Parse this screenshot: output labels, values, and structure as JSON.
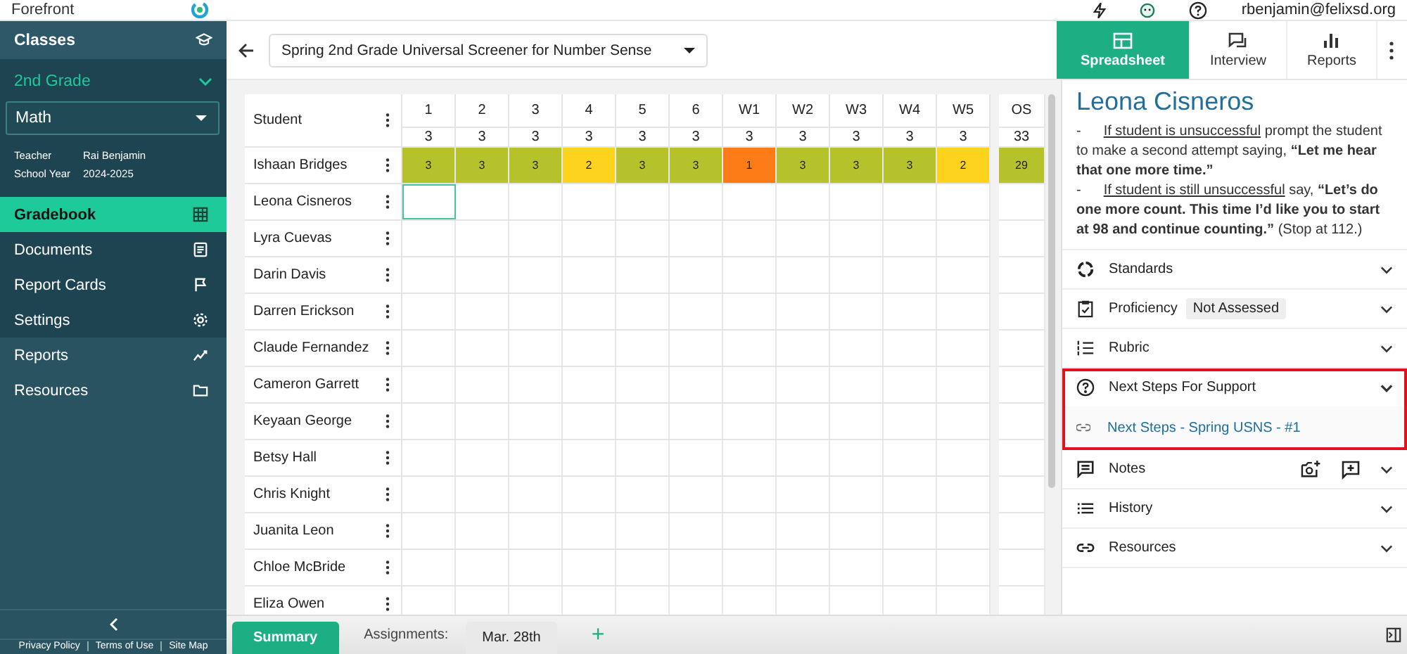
{
  "top_bar": {
    "brand": "Forefront",
    "user_email": "rbenjamin@felixsd.org"
  },
  "sidebar": {
    "classes_label": "Classes",
    "class_name": "2nd Grade",
    "subject": "Math",
    "info": [
      {
        "label": "Teacher",
        "value": "Rai Benjamin"
      },
      {
        "label": "School Year",
        "value": "2024-2025"
      }
    ],
    "items": [
      {
        "label": "Gradebook",
        "selected": true,
        "kind": "class"
      },
      {
        "label": "Documents",
        "selected": false,
        "kind": "class"
      },
      {
        "label": "Report Cards",
        "selected": false,
        "kind": "class"
      },
      {
        "label": "Settings",
        "selected": false,
        "kind": "class"
      },
      {
        "label": "Reports",
        "selected": false,
        "kind": "global"
      },
      {
        "label": "Resources",
        "selected": false,
        "kind": "global"
      }
    ],
    "footer_links": [
      "Privacy Policy",
      "Terms of Use",
      "Site Map"
    ]
  },
  "assessment_select": {
    "value": "Spring 2nd Grade Universal Screener for Number Sense"
  },
  "view_tabs": [
    {
      "label": "Spreadsheet",
      "selected": true
    },
    {
      "label": "Interview",
      "selected": false
    },
    {
      "label": "Reports",
      "selected": false
    }
  ],
  "table": {
    "student_header": "Student",
    "columns": [
      {
        "label": "1",
        "max": "3"
      },
      {
        "label": "2",
        "max": "3"
      },
      {
        "label": "3",
        "max": "3"
      },
      {
        "label": "4",
        "max": "3"
      },
      {
        "label": "5",
        "max": "3"
      },
      {
        "label": "6",
        "max": "3"
      },
      {
        "label": "W1",
        "max": "3"
      },
      {
        "label": "W2",
        "max": "3"
      },
      {
        "label": "W3",
        "max": "3"
      },
      {
        "label": "W4",
        "max": "3"
      },
      {
        "label": "W5",
        "max": "3"
      }
    ],
    "total_column": {
      "label": "OS",
      "max": "33"
    },
    "rows": [
      {
        "student": "Ishaan Bridges",
        "cell_focused": false,
        "total": {
          "value": "29",
          "color": "#b5c22b"
        },
        "scores": [
          {
            "value": "3",
            "color": "#b5c22b"
          },
          {
            "value": "3",
            "color": "#b5c22b"
          },
          {
            "value": "3",
            "color": "#b5c22b"
          },
          {
            "value": "2",
            "color": "#fdd31d"
          },
          {
            "value": "3",
            "color": "#b5c22b"
          },
          {
            "value": "3",
            "color": "#b5c22b"
          },
          {
            "value": "1",
            "color": "#fb7c16"
          },
          {
            "value": "3",
            "color": "#b5c22b"
          },
          {
            "value": "3",
            "color": "#b5c22b"
          },
          {
            "value": "3",
            "color": "#b5c22b"
          },
          {
            "value": "2",
            "color": "#fdd31d"
          }
        ]
      },
      {
        "student": "Leona Cisneros",
        "cell_focused": true
      },
      {
        "student": "Lyra Cuevas",
        "cell_focused": false
      },
      {
        "student": "Darin Davis",
        "cell_focused": false
      },
      {
        "student": "Darren Erickson",
        "cell_focused": false
      },
      {
        "student": "Claude Fernandez",
        "cell_focused": false
      },
      {
        "student": "Cameron Garrett",
        "cell_focused": false
      },
      {
        "student": "Keyaan George",
        "cell_focused": false
      },
      {
        "student": "Betsy Hall",
        "cell_focused": false
      },
      {
        "student": "Chris Knight",
        "cell_focused": false
      },
      {
        "student": "Juanita Leon",
        "cell_focused": false
      },
      {
        "student": "Chloe McBride",
        "cell_focused": false
      },
      {
        "student": "Eliza Owen",
        "cell_focused": false
      }
    ]
  },
  "bottom_bar": {
    "summary_tab": {
      "label": "Summary",
      "selected": true
    },
    "assignments_label": "Assignments:",
    "assignment_tabs": [
      {
        "label": "Mar. 28th",
        "selected": false
      }
    ],
    "add_symbol": "+"
  },
  "detail_panel": {
    "student_name": "Leona Cisneros",
    "prompts": [
      {
        "bullet": "-",
        "condition": "If student is unsuccessful",
        "text": " prompt the student to make a second attempt saying, **“Let me hear that one more time.”**"
      },
      {
        "bullet": "-",
        "condition": "If student is still unsuccessful",
        "text": " say, **“Let’s do one more count. This time I’d like you to start at 98 and continue counting.”** (Stop at 112.)"
      }
    ],
    "sections": [
      {
        "kind": "standards",
        "label": "Standards",
        "expanded": false,
        "highlighted": false
      },
      {
        "kind": "proficiency",
        "label": "Proficiency",
        "badge": "Not Assessed",
        "expanded": false,
        "highlighted": false
      },
      {
        "kind": "rubric",
        "label": "Rubric",
        "expanded": false,
        "highlighted": false
      },
      {
        "kind": "support",
        "label": "Next Steps For Support",
        "expanded": true,
        "highlighted": true,
        "links": [
          "Next Steps - Spring USNS - #1"
        ]
      },
      {
        "kind": "notes",
        "label": "Notes",
        "expanded": false,
        "highlighted": false
      },
      {
        "kind": "history",
        "label": "History",
        "expanded": false,
        "highlighted": false
      },
      {
        "kind": "resources",
        "label": "Resources",
        "expanded": false,
        "highlighted": false
      }
    ]
  }
}
